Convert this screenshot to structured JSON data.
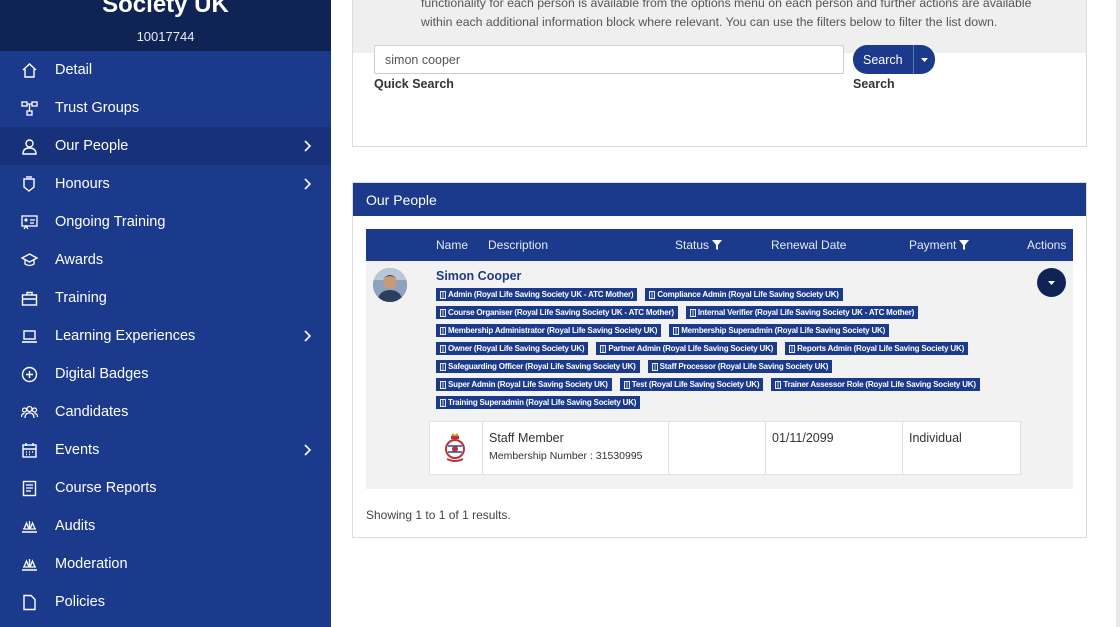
{
  "sidebar": {
    "org_name": "Society UK",
    "org_number": "10017744",
    "items": [
      {
        "label": "Detail",
        "icon": "home-icon"
      },
      {
        "label": "Trust Groups",
        "icon": "hierarchy-icon"
      },
      {
        "label": "Our People",
        "icon": "person-icon",
        "active": true,
        "chevron": true
      },
      {
        "label": "Honours",
        "icon": "honours-icon",
        "chevron": true
      },
      {
        "label": "Ongoing Training",
        "icon": "presentation-icon"
      },
      {
        "label": "Awards",
        "icon": "graduation-cap-icon"
      },
      {
        "label": "Training",
        "icon": "briefcase-icon"
      },
      {
        "label": "Learning Experiences",
        "icon": "laptop-icon",
        "chevron": true
      },
      {
        "label": "Digital Badges",
        "icon": "badge-plus-icon"
      },
      {
        "label": "Candidates",
        "icon": "group-icon"
      },
      {
        "label": "Events",
        "icon": "calendar-icon",
        "chevron": true
      },
      {
        "label": "Course Reports",
        "icon": "report-icon"
      },
      {
        "label": "Audits",
        "icon": "scales-icon"
      },
      {
        "label": "Moderation",
        "icon": "scales-icon"
      },
      {
        "label": "Policies",
        "icon": "document-icon"
      }
    ]
  },
  "info": {
    "text": "functionality for each person is available from the options menu on each person and further actions are available within each additional information block where relevant. You can use the filters below to filter the list down."
  },
  "search": {
    "quick_label": "Quick Search",
    "value": "simon cooper",
    "search_label": "Search",
    "button_label": "Search"
  },
  "people": {
    "title": "Our People",
    "columns": {
      "name": "Name",
      "description": "Description",
      "status": "Status",
      "renewal": "Renewal Date",
      "payment": "Payment",
      "actions": "Actions"
    },
    "person": {
      "name": "Simon Cooper",
      "roles": [
        "Admin (Royal Life Saving Society UK - ATC Mother)",
        "Compliance Admin (Royal Life Saving Society UK)",
        "Course Organiser (Royal Life Saving Society UK - ATC Mother)",
        "Internal Verifier (Royal Life Saving Society UK - ATC Mother)",
        "Membership Administrator (Royal Life Saving Society UK)",
        "Membership Superadmin (Royal Life Saving Society UK)",
        "Owner (Royal Life Saving Society UK)",
        "Partner Admin (Royal Life Saving Society UK)",
        "Reports Admin (Royal Life Saving Society UK)",
        "Safeguarding Officer (Royal Life Saving Society UK)",
        "Staff Processor (Royal Life Saving Society UK)",
        "Super Admin (Royal Life Saving Society UK)",
        "Test (Royal Life Saving Society UK)",
        "Trainer Assessor Role (Royal Life Saving Society UK)",
        "Training Superadmin (Royal Life Saving Society UK)"
      ],
      "membership": {
        "type": "Staff Member",
        "number_text": "Membership Number : 31530995",
        "status": "",
        "renewal_date": "01/11/2099",
        "payment": "Individual"
      }
    },
    "showing_text": "Showing 1 to 1 of 1 results."
  }
}
